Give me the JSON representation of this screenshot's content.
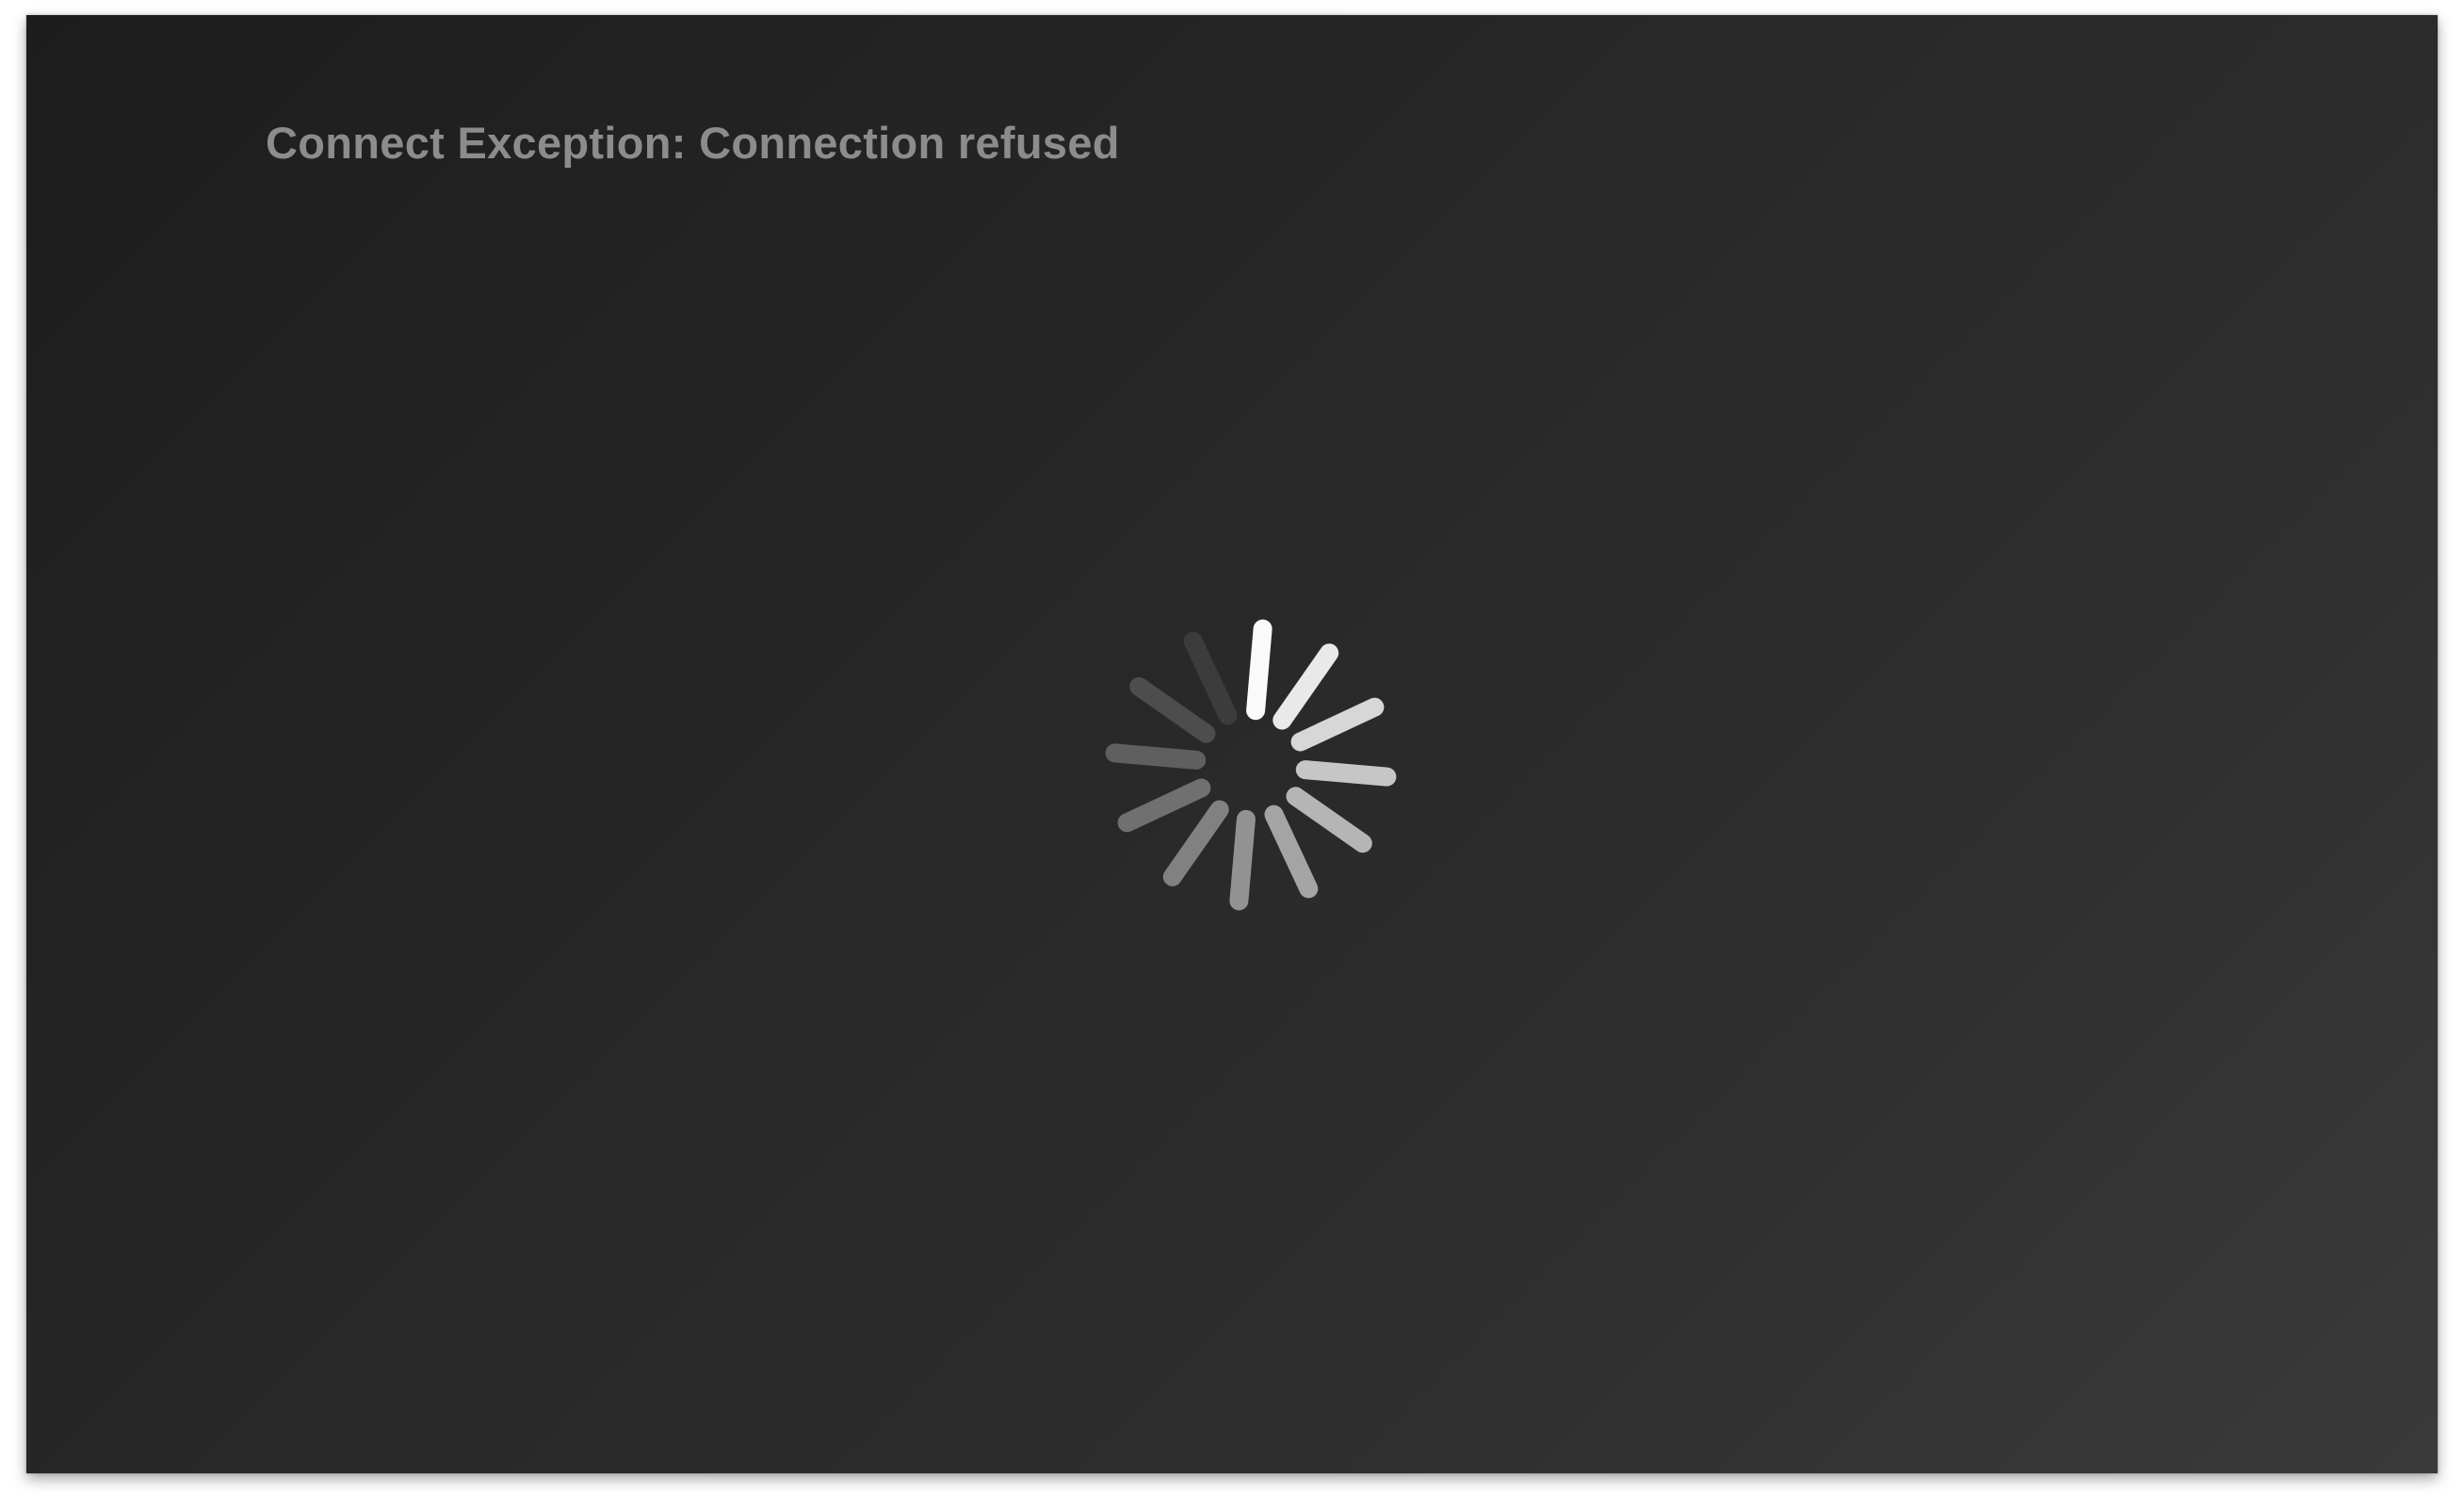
{
  "error": {
    "message": "Connect Exception: Connection refused"
  },
  "spinner": {
    "icon": "loading-spinner-icon",
    "spoke_count": 12,
    "state": "loading"
  }
}
